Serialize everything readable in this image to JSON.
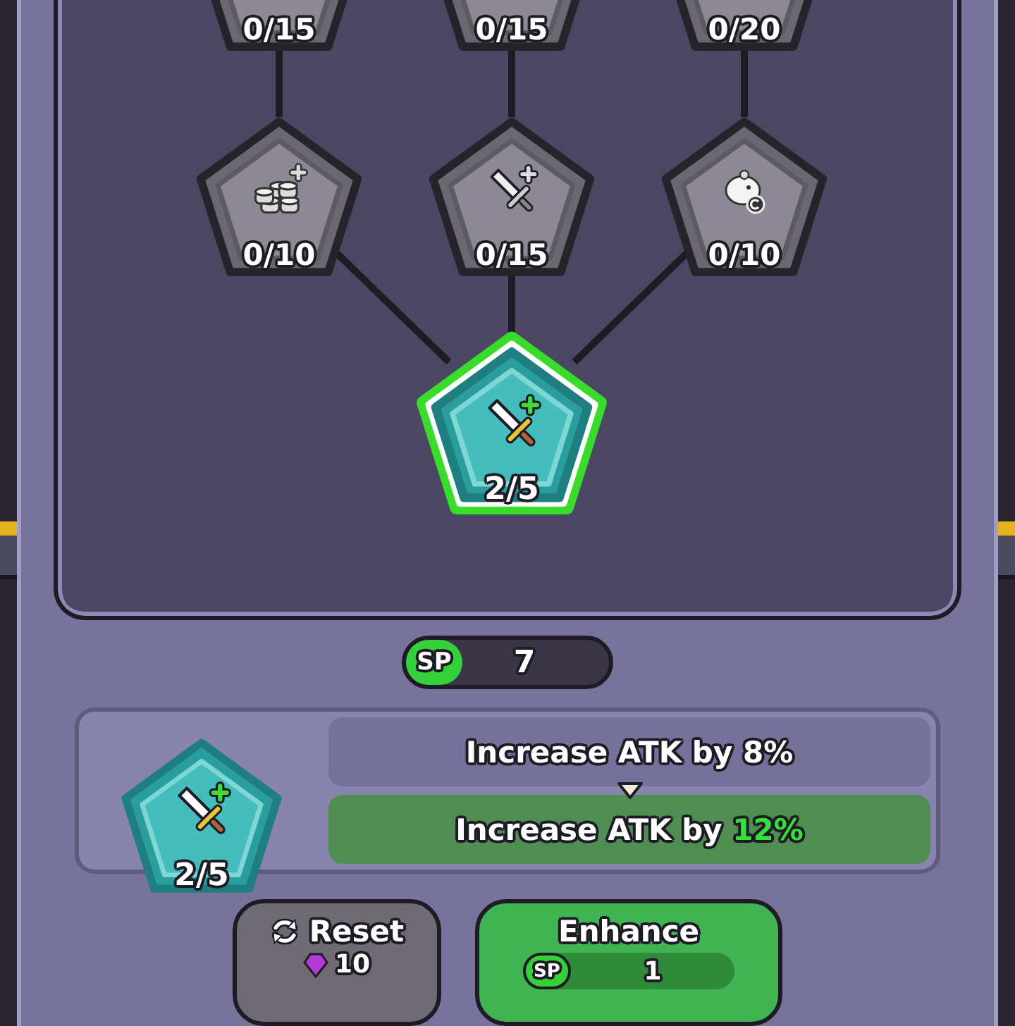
{
  "skill_tree": {
    "root": {
      "level": "2/5",
      "selected": true,
      "unlocked": true,
      "children": [
        {
          "level": "0/10",
          "selected": false,
          "unlocked": false,
          "children": [
            {
              "level": "0/15",
              "selected": false,
              "unlocked": false
            }
          ]
        },
        {
          "level": "0/15",
          "selected": false,
          "unlocked": false,
          "children": [
            {
              "level": "0/15",
              "selected": false,
              "unlocked": false
            }
          ]
        },
        {
          "level": "0/10",
          "selected": false,
          "unlocked": false,
          "children": [
            {
              "level": "0/20",
              "selected": false,
              "unlocked": false
            }
          ]
        }
      ]
    }
  },
  "sp": {
    "label": "SP",
    "value": "7"
  },
  "detail": {
    "level": "2/5",
    "unlocked": true,
    "current": "Increase ATK by 8%",
    "next": "Increase ATK by **12%**"
  },
  "buttons": [
    {
      "kind": "reset",
      "label": "Reset",
      "cost": "10"
    },
    {
      "kind": "enhance",
      "label": "Enhance",
      "cost_label": "SP",
      "cost": "1"
    }
  ]
}
